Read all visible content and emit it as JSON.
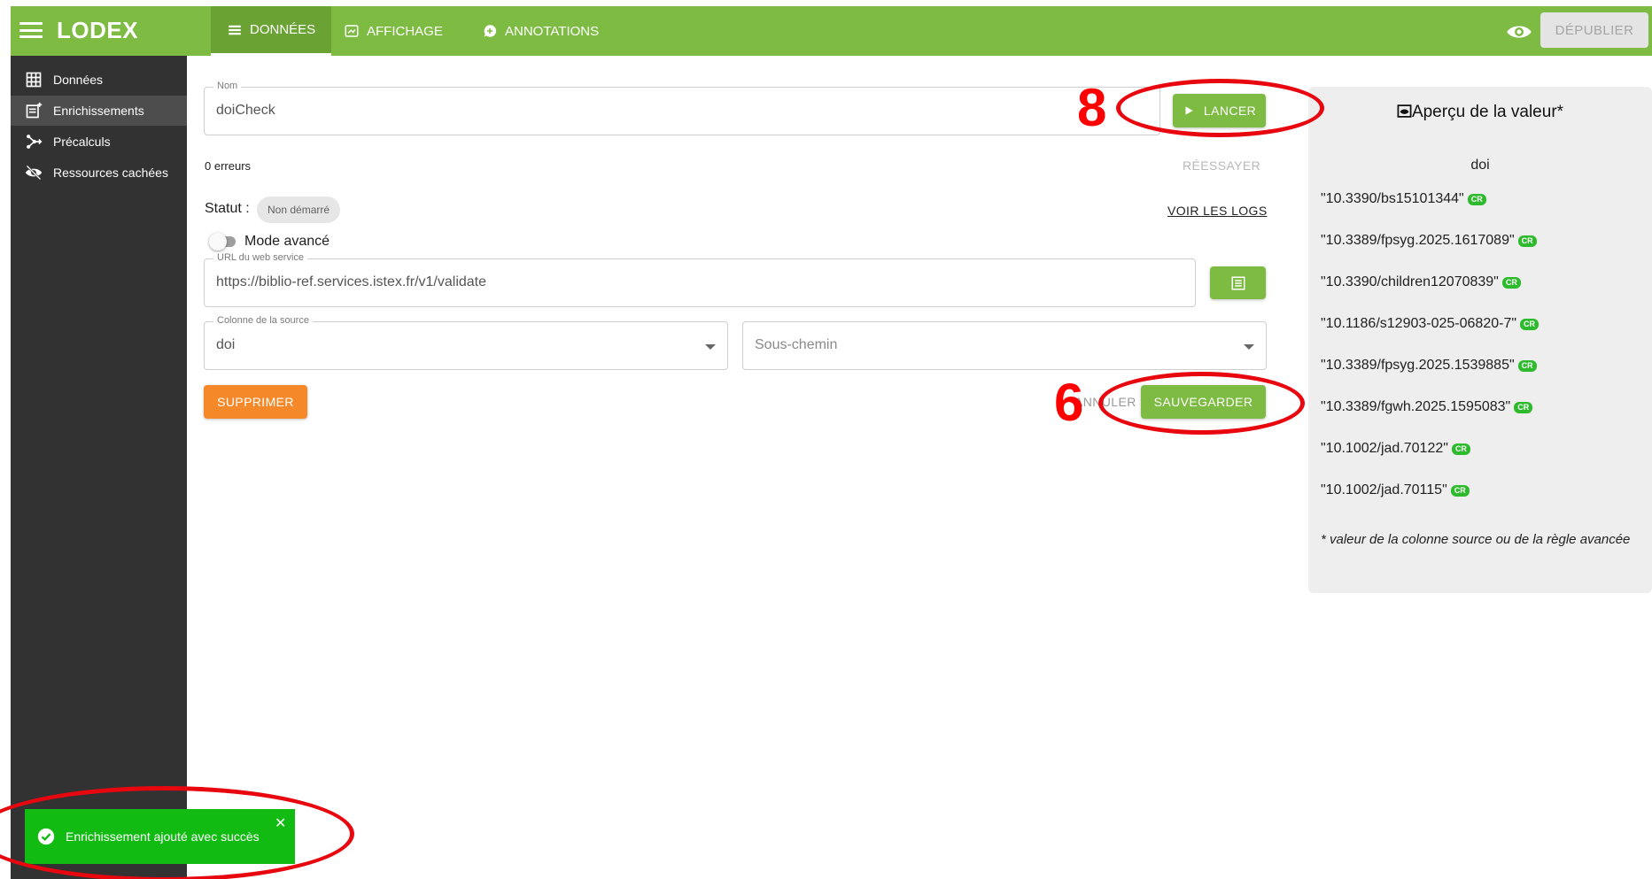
{
  "app": {
    "logo": "LODEX"
  },
  "tabs": [
    {
      "label": "DONNÉES",
      "icon": "list-icon"
    },
    {
      "label": "AFFICHAGE",
      "icon": "display-icon"
    },
    {
      "label": "ANNOTATIONS",
      "icon": "annotation-icon"
    }
  ],
  "topbar": {
    "publish_label": "DÉPUBLIER"
  },
  "sidebar": {
    "items": [
      {
        "label": "Données",
        "icon": "grid-icon"
      },
      {
        "label": "Enrichissements",
        "icon": "enrich-icon"
      },
      {
        "label": "Précalculs",
        "icon": "precalc-icon"
      },
      {
        "label": "Ressources cachées",
        "icon": "eye-off-icon"
      }
    ]
  },
  "form": {
    "name_legend": "Nom",
    "name_value": "doiCheck",
    "launch_label": "LANCER",
    "errors_text": "0 erreurs",
    "retry_label": "RÉESSAYER",
    "status_label": "Statut :",
    "status_value": "Non démarré",
    "logs_label": "VOIR LES LOGS",
    "advanced_label": "Mode avancé",
    "url_legend": "URL du web service",
    "url_value": "https://biblio-ref.services.istex.fr/v1/validate",
    "column_legend": "Colonne de la source",
    "column_value": "doi",
    "subpath_placeholder": "Sous-chemin",
    "delete_label": "SUPPRIMER",
    "cancel_label": "ANNULER",
    "save_label": "SAUVEGARDER"
  },
  "preview": {
    "title": "Aperçu de la valeur*",
    "column": "doi",
    "badge": "CR",
    "values": [
      "\"10.3390/bs15101344\"",
      "\"10.3389/fpsyg.2025.1617089\"",
      "\"10.3390/children12070839\"",
      "\"10.1186/s12903-025-06820-7\"",
      "\"10.3389/fpsyg.2025.1539885\"",
      "\"10.3389/fgwh.2025.1595083\"",
      "\"10.1002/jad.70122\"",
      "\"10.1002/jad.70115\""
    ],
    "note": "* valeur de la colonne source ou de la règle avancée"
  },
  "snackbar": {
    "message": "Enrichissement ajouté avec succès"
  },
  "annotations": {
    "step_launch": "8",
    "step_save": "6"
  },
  "colors": {
    "brand": "#7dbb42",
    "accent_orange": "#f5892a",
    "success": "#12bb12",
    "annotation_red": "#e8070f"
  }
}
